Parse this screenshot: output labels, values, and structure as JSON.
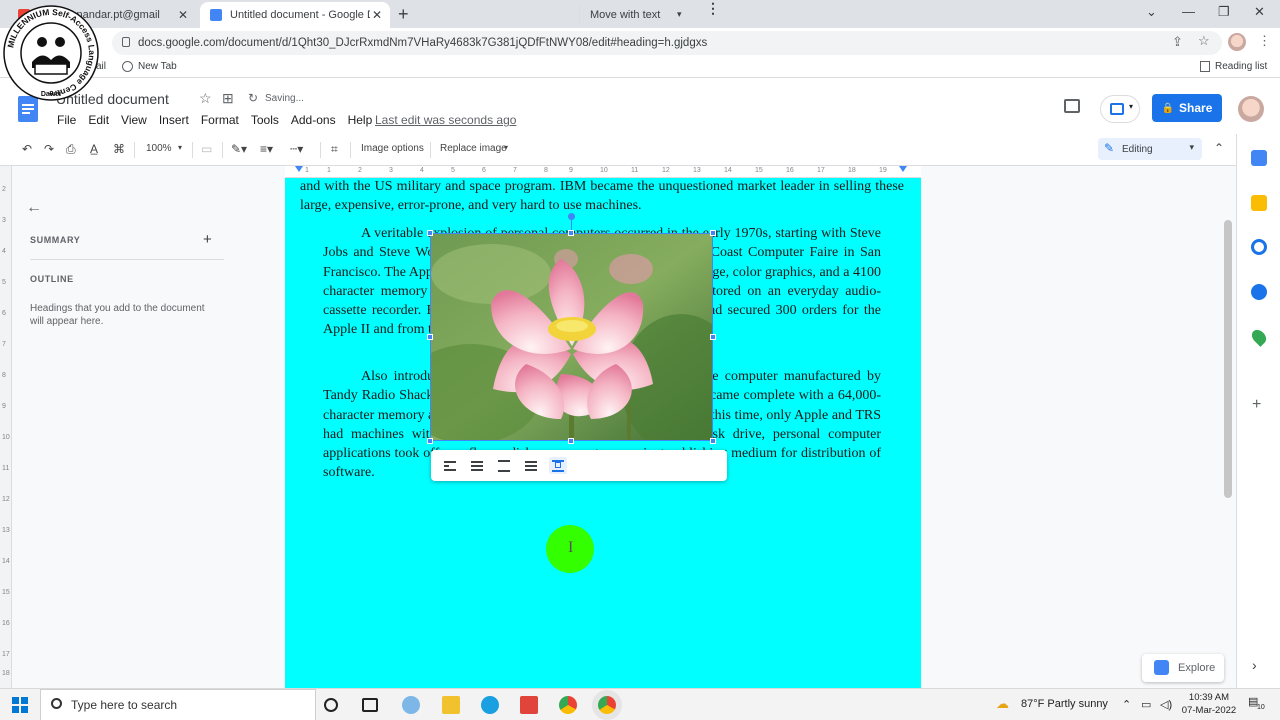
{
  "browser": {
    "tabs": [
      {
        "title": "(3) - toenandar.pt@gmail",
        "active": false
      },
      {
        "title": "Untitled document - Google Docs",
        "active": true
      }
    ],
    "url": "docs.google.com/document/d/1Qht30_DJcrRxmdNm7VHaRy4683k7G381jQDfFtNWY08/edit#heading=h.gjdgxs",
    "bookmarks": [
      "ail",
      "New Tab"
    ],
    "reading_list": "Reading list"
  },
  "docs": {
    "title": "Untitled document",
    "saving": "Saving...",
    "menu": [
      "File",
      "Edit",
      "View",
      "Insert",
      "Format",
      "Tools",
      "Add-ons",
      "Help"
    ],
    "last_edit": "Last edit was seconds ago",
    "share_label": "Share",
    "accent_color": "#1a73e8"
  },
  "toolbar": {
    "zoom": "100%",
    "image_options": "Image options",
    "replace_image": "Replace image",
    "mode": "Editing"
  },
  "outline": {
    "summary": "SUMMARY",
    "outline": "OUTLINE",
    "hint": "Headings that you add to the document will appear here."
  },
  "ruler": {
    "horizontal": [
      "1",
      "1",
      "2",
      "3",
      "4",
      "5",
      "6",
      "7",
      "8",
      "9",
      "10",
      "11",
      "12",
      "13",
      "14",
      "15",
      "16",
      "17",
      "18",
      "19"
    ],
    "vertical": [
      "2",
      "3",
      "4",
      "5",
      "6",
      "7",
      "8",
      "9",
      "10",
      "11",
      "12",
      "13",
      "14",
      "15",
      "16",
      "17",
      "18"
    ]
  },
  "document": {
    "page_color": "#00ffff",
    "paragraphs": [
      "and with the US military and space program. IBM became the unquestioned market leader in selling these large, expensive, error-prone, and very hard to use machines.",
      "A veritable explosion of personal computers occurred in the early 1970s, starting with Steve Jobs and Steve Wozniak exhibiting the Apple II at the First West Coast Computer Faire in San Francisco. The Apple II boasted built-in BASIC programming language, color graphics, and a 4100 character memory for only $1298. Programs and data could be stored on an everyday audio-cassette recorder. Before the end of the faire, Wozniak and Jobs had secured 300 orders for the Apple II and from there Apple just took off.",
      "Also introduced in 1977 was the TRS-80. This was a home computer manufactured by Tandy Radio Shack. In its second incarnation, the TRS-80 Model II came complete with a 64,000-character memory and a disk drive to store programs and data on. At this time, only Apple and TRS had machines with disk drives. With the introduction of the disk drive, personal computer applications took off as a floppy disk was a most convenient publishing medium for distribution of software."
    ]
  },
  "image_toolbar": {
    "wrap_options": [
      "in-line",
      "wrap-text",
      "break-text",
      "behind-text",
      "in-front-of-text"
    ],
    "position": "Move with text"
  },
  "explore": "Explore",
  "taskbar": {
    "search_placeholder": "Type here to search",
    "weather": "87°F  Partly sunny",
    "time": "10:39 AM",
    "date": "07-Mar-2022",
    "notifications": "10"
  },
  "watermark": {
    "text": "MILLENNIUM Self-Access Language Centre",
    "sub": "Dawei"
  }
}
